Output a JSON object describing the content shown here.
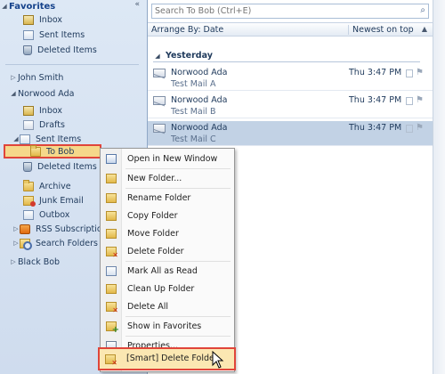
{
  "folder_pane": {
    "header": "Favorites",
    "collapse_glyph": "«",
    "favorites": [
      {
        "label": "Inbox",
        "icon": "inbox-icon"
      },
      {
        "label": "Sent Items",
        "icon": "sent-items-icon"
      },
      {
        "label": "Deleted Items",
        "icon": "deleted-items-icon"
      }
    ],
    "accounts": [
      {
        "label": "John Smith",
        "expanded": false
      },
      {
        "label": "Norwood Ada",
        "expanded": true
      },
      {
        "label": "Black Bob",
        "expanded": false
      }
    ],
    "norwood_folders": [
      {
        "label": "Inbox",
        "icon": "inbox-icon"
      },
      {
        "label": "Drafts",
        "icon": "drafts-icon"
      },
      {
        "label": "Sent Items",
        "icon": "sent-items-icon"
      },
      {
        "label": "To Bob",
        "icon": "folder-icon",
        "selected": true
      },
      {
        "label": "Deleted Items",
        "icon": "deleted-items-icon"
      },
      {
        "label": "Archive",
        "icon": "folder-icon"
      },
      {
        "label": "Junk Email",
        "icon": "junk-email-icon"
      },
      {
        "label": "Outbox",
        "icon": "outbox-icon"
      },
      {
        "label": "RSS Subscriptio",
        "icon": "rss-icon"
      },
      {
        "label": "Search Folders",
        "icon": "search-folder-icon"
      }
    ]
  },
  "mail_list": {
    "search_placeholder": "Search To Bob (Ctrl+E)",
    "arrange_label": "Arrange By: Date",
    "order_label": "Newest on top",
    "group_label": "Yesterday",
    "messages": [
      {
        "from": "Norwood Ada",
        "subject": "Test Mail A",
        "date": "Thu 3:47 PM",
        "selected": false
      },
      {
        "from": "Norwood Ada",
        "subject": "Test Mail B",
        "date": "Thu 3:47 PM",
        "selected": false
      },
      {
        "from": "Norwood Ada",
        "subject": "Test Mail C",
        "date": "Thu 3:47 PM",
        "selected": true
      }
    ]
  },
  "context_menu": {
    "items": [
      {
        "label": "Open in New Window",
        "icon": "new-window-icon"
      },
      {
        "label": "New Folder...",
        "icon": "new-folder-icon"
      },
      {
        "label": "Rename Folder",
        "icon": "rename-folder-icon"
      },
      {
        "label": "Copy Folder",
        "icon": "copy-folder-icon"
      },
      {
        "label": "Move Folder",
        "icon": "move-folder-icon"
      },
      {
        "label": "Delete Folder",
        "icon": "delete-folder-icon"
      },
      {
        "label": "Mark All as Read",
        "icon": "mark-read-icon"
      },
      {
        "label": "Clean Up Folder",
        "icon": "clean-up-icon"
      },
      {
        "label": "Delete All",
        "icon": "delete-all-icon"
      },
      {
        "label": "Show in Favorites",
        "icon": "favorites-icon"
      },
      {
        "label": "Properties...",
        "icon": "properties-icon"
      },
      {
        "label": "[Smart] Delete Folder",
        "icon": "smart-delete-icon",
        "highlighted": true
      }
    ]
  },
  "colors": {
    "folder_pane_bg": "#cfdcee",
    "selection_bg": "#c2d2e5",
    "highlight_border": "#e0453a",
    "text": "#1e395b"
  }
}
